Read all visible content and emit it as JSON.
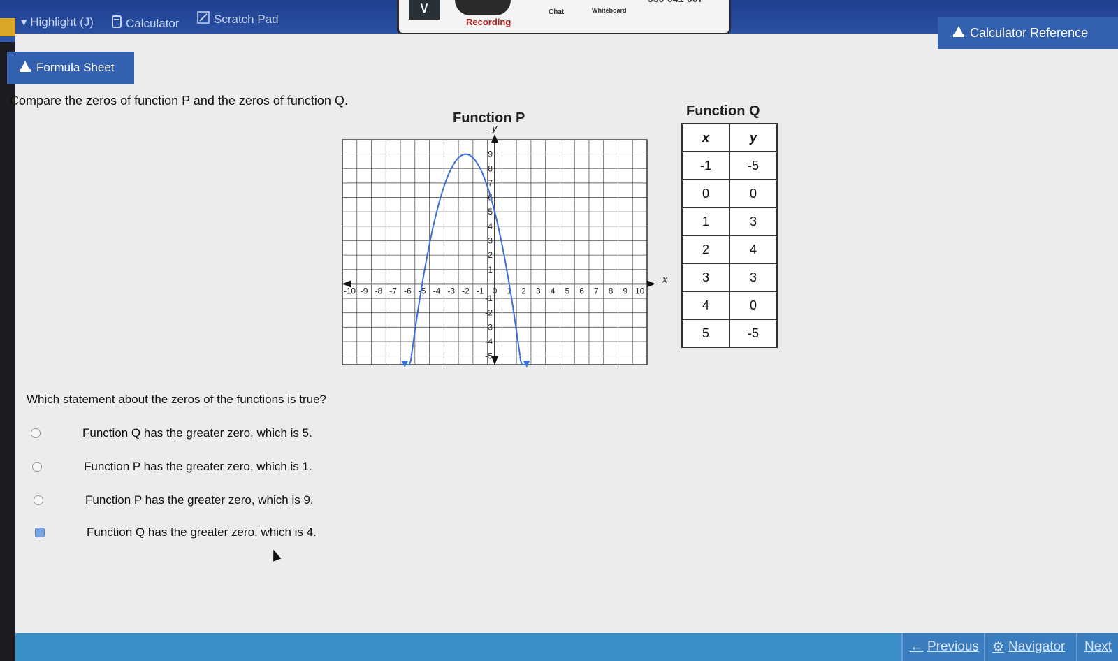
{
  "toolbar": {
    "highlight_label": "▾ Highlight (J)",
    "calculator_label": "Calculator",
    "scratch_label": "Scratch Pad",
    "calc_ref_label": "Calculator Reference",
    "formula_label": "Formula Sheet"
  },
  "recording": {
    "recording_label": "Recording",
    "chat_label": "Chat",
    "whiteboard_label": "Whiteboard",
    "phone": "550-041-007"
  },
  "prompt": "Compare the zeros of function P and the zeros of function Q.",
  "function_p": {
    "title": "Function P",
    "x_axis_label": "x",
    "y_axis_label": "y",
    "x_ticks": [
      "-10",
      "-9",
      "-8",
      "-7",
      "-6",
      "-5",
      "-4",
      "-3",
      "-2",
      "-1",
      "0",
      "1",
      "2",
      "3",
      "4",
      "5",
      "6",
      "7",
      "8",
      "9",
      "10"
    ],
    "y_ticks": [
      "-5",
      "-4",
      "-3",
      "-2",
      "-1",
      "1",
      "2",
      "3",
      "4",
      "5",
      "6",
      "7",
      "8",
      "9"
    ],
    "curve_color": "#3a6fd8"
  },
  "chart_data": {
    "type": "line",
    "title": "Function P",
    "xlabel": "x",
    "ylabel": "y",
    "xlim": [
      -10,
      10
    ],
    "ylim": [
      -5,
      9
    ],
    "series": [
      {
        "name": "",
        "x": [
          -6.2,
          -5,
          -4,
          -3,
          -2,
          -1,
          0,
          1,
          2.2
        ],
        "y": [
          -5,
          0,
          5,
          8,
          9,
          8,
          5,
          0,
          -5
        ]
      }
    ]
  },
  "function_q": {
    "title": "Function Q",
    "headers": [
      "x",
      "y"
    ],
    "rows": [
      [
        "-1",
        "-5"
      ],
      [
        "0",
        "0"
      ],
      [
        "1",
        "3"
      ],
      [
        "2",
        "4"
      ],
      [
        "3",
        "3"
      ],
      [
        "4",
        "0"
      ],
      [
        "5",
        "-5"
      ]
    ]
  },
  "question": "Which statement about the zeros of the functions is true?",
  "options": [
    {
      "label": "Function Q has the greater zero, which is 5.",
      "selected": false
    },
    {
      "label": "Function P has the greater zero, which is 1.",
      "selected": false
    },
    {
      "label": "Function P has the greater zero, which is 9.",
      "selected": false
    },
    {
      "label": "Function Q has the greater zero, which is 4.",
      "selected": true
    }
  ],
  "nav": {
    "previous_label": "Previous",
    "navigator_label": "Navigator",
    "next_label": "Next"
  }
}
